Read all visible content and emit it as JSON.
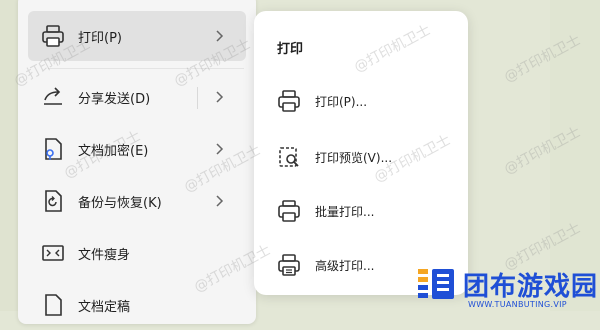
{
  "main_menu": {
    "items": [
      {
        "label": "打印(P)",
        "icon": "printer-icon",
        "has_submenu": true,
        "active": true
      },
      {
        "label": "分享发送(D)",
        "icon": "share-icon",
        "has_submenu": true
      },
      {
        "label": "文档加密(E)",
        "icon": "document-lock-icon",
        "has_submenu": true
      },
      {
        "label": "备份与恢复(K)",
        "icon": "backup-restore-icon",
        "has_submenu": true
      },
      {
        "label": "文件瘦身",
        "icon": "file-compress-icon",
        "has_submenu": false
      },
      {
        "label": "文档定稿",
        "icon": "document-finalize-icon",
        "has_submenu": false
      }
    ]
  },
  "submenu": {
    "title": "打印",
    "items": [
      {
        "label": "打印(P)...",
        "icon": "printer-icon"
      },
      {
        "label": "打印预览(V)...",
        "icon": "print-preview-icon"
      },
      {
        "label": "批量打印...",
        "icon": "batch-print-icon"
      },
      {
        "label": "高级打印...",
        "icon": "advanced-print-icon"
      }
    ]
  },
  "watermark_text": "@打印机卫士",
  "logo": {
    "text": "团布游戏园",
    "subtext": "WWW.TUANBUTING.VIP",
    "color": "#1f4fd6",
    "accent": "#f5a623"
  },
  "colors": {
    "active_item": "#e1e1e1",
    "menu_bg": "#f5f5f5",
    "background": "#e3e7d6"
  }
}
